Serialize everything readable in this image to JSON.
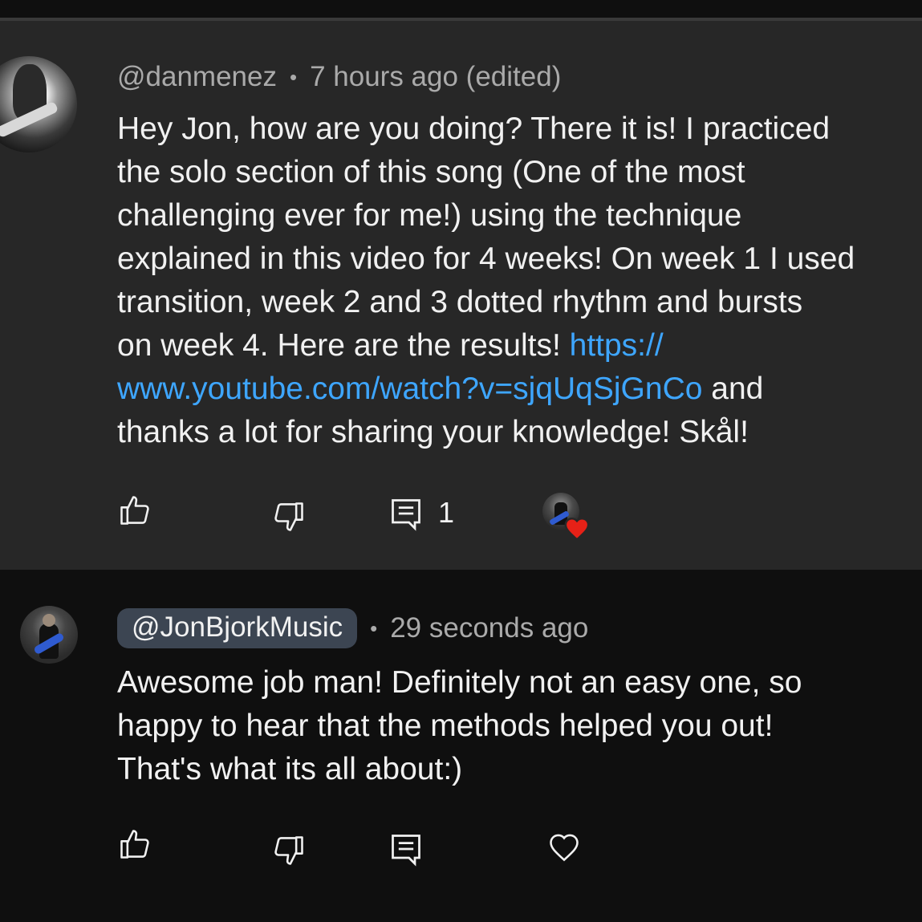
{
  "comments": [
    {
      "author": "@danmenez",
      "meta_separator": "•",
      "time": "7 hours ago (edited)",
      "body_lines": [
        [
          {
            "text": "Hey Jon, how are you doing? There it is! I practiced"
          }
        ],
        [
          {
            "text": "the solo section of this song (One of the most"
          }
        ],
        [
          {
            "text": "challenging ever for me!) using the technique"
          }
        ],
        [
          {
            "text": "explained in this video for 4 weeks! On week 1 I used"
          }
        ],
        [
          {
            "text": "transition, week 2 and 3 dotted rhythm and bursts"
          }
        ],
        [
          {
            "text": "on week 4. Here are the results! "
          },
          {
            "text": "https://",
            "link": true
          }
        ],
        [
          {
            "text": "www.youtube.com/watch?v=sjqUqSjGnCo",
            "link": true
          },
          {
            "text": " and"
          }
        ],
        [
          {
            "text": "thanks a lot for sharing your knowledge! Skål!"
          }
        ]
      ],
      "reply_count": "1",
      "like_icon": "thumbs-up-icon",
      "dislike_icon": "thumbs-down-icon",
      "reply_icon": "comment-icon",
      "creator_heart": "creator-heart-badge"
    },
    {
      "author": "@JonBjorkMusic",
      "meta_separator": "•",
      "time": "29 seconds ago",
      "body_lines": [
        [
          {
            "text": "Awesome job man! Definitely not an easy one, so"
          }
        ],
        [
          {
            "text": "happy to hear that the methods helped you out!"
          }
        ],
        [
          {
            "text": "That's what its all about:)"
          }
        ]
      ],
      "like_icon": "thumbs-up-icon",
      "dislike_icon": "thumbs-down-icon",
      "reply_icon": "comment-icon",
      "heart_icon": "heart-outline-icon"
    }
  ],
  "colors": {
    "page_bg": "#0f0f0f",
    "highlight_bg": "#272727",
    "text": "#f1f1f1",
    "meta_text": "#aaaaaa",
    "link": "#3ea6ff",
    "handle_pill_bg": "#3c4552",
    "heart_red": "#e62117"
  }
}
